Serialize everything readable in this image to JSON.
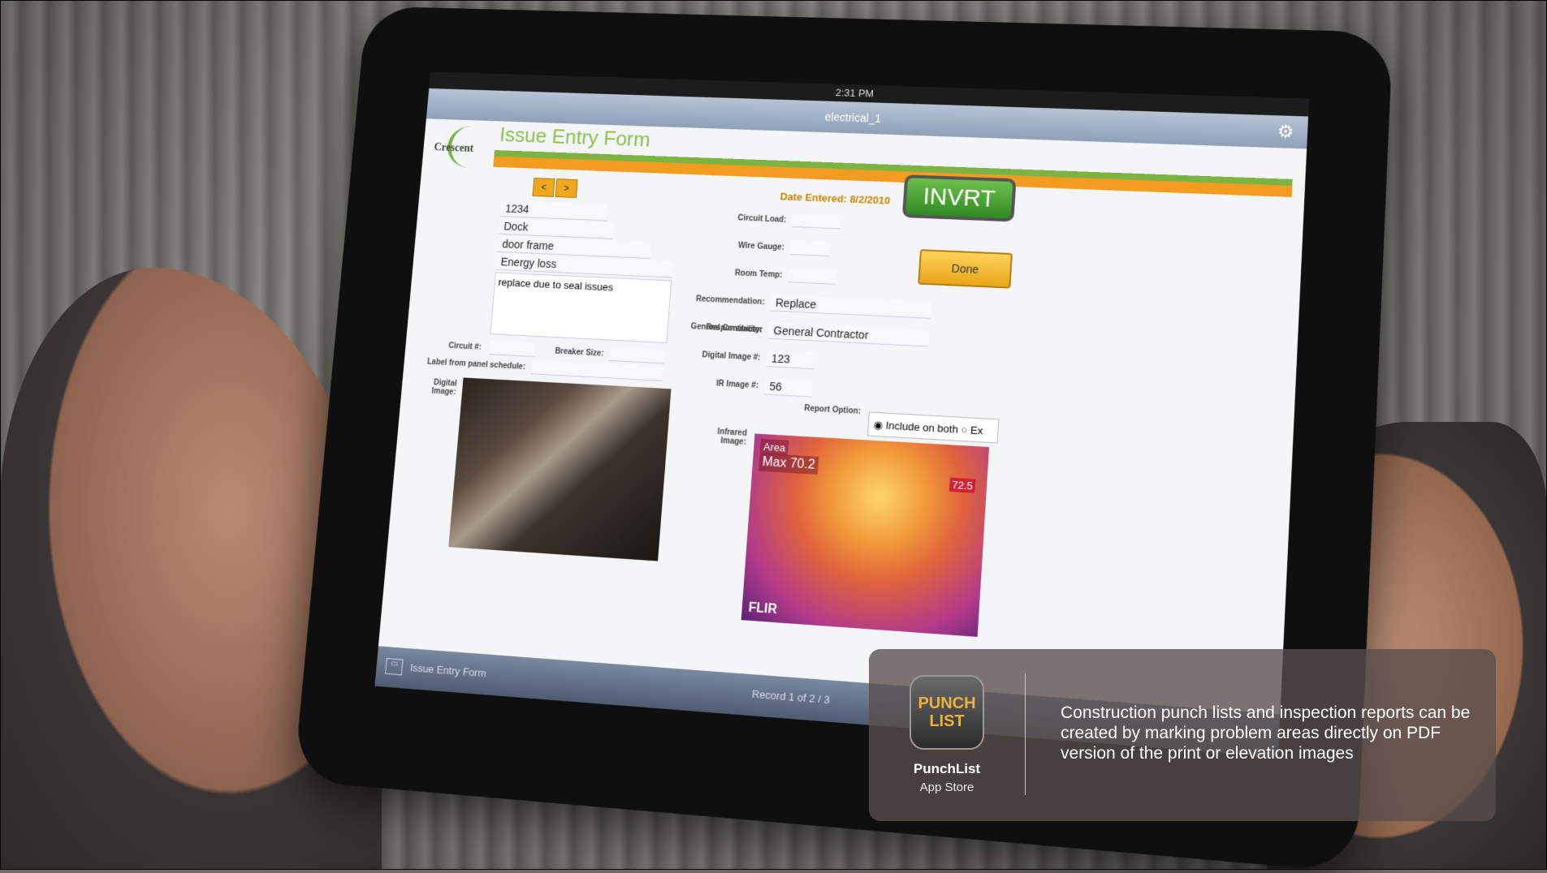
{
  "device": {
    "status_time": "2:31 PM",
    "window_title": "electrical_1",
    "logo_text": "Crescent",
    "form_title": "Issue Entry Form",
    "prev_label": "<",
    "next_label": ">",
    "date_entered": "Date Entered: 8/2/2010",
    "brand_badge": "INVRT",
    "done_label": "Done",
    "fields": {
      "store_value": "1234",
      "location_value": "Dock",
      "panel_equip_value": "door frame",
      "issue_value": "Energy loss",
      "description_value": "replace due to seal issues",
      "circuit_label": "Circuit #:",
      "breaker_label": "Breaker Size:",
      "panel_schedule_label": "Label from panel schedule:",
      "digital_image_label": "Digital Image:",
      "circuit_load_label": "Circuit Load:",
      "wire_gauge_label": "Wire Gauge:",
      "room_temp_label": "Room Temp:",
      "recommendation_label": "Recommendation:",
      "recommendation_value": "Replace",
      "responsibility_label": "Responsibility:",
      "responsibility_value": "General Contractor",
      "digital_image_no_label": "Digital Image #:",
      "digital_image_no_value": "123",
      "ir_image_no_label": "IR Image #:",
      "ir_image_no_value": "56",
      "report_option_label": "Report Option:",
      "report_option_value": "Include on both",
      "report_option_other": "Ex",
      "infrared_image_label": "Infrared Image:"
    },
    "ir": {
      "area_label": "Area",
      "max_label": "Max",
      "max_value": "70.2",
      "scale_top": "72.5",
      "brand": "FLIR"
    },
    "bottom": {
      "title": "Issue Entry Form",
      "record": "Record 1 of 2 / 3"
    }
  },
  "overlay": {
    "app_icon_text": "PUNCH LIST",
    "app_name": "PunchList",
    "store_name": "App Store",
    "caption": "Construction punch lists and inspection reports can be created by marking problem areas directly on PDF version of the print or elevation images"
  }
}
